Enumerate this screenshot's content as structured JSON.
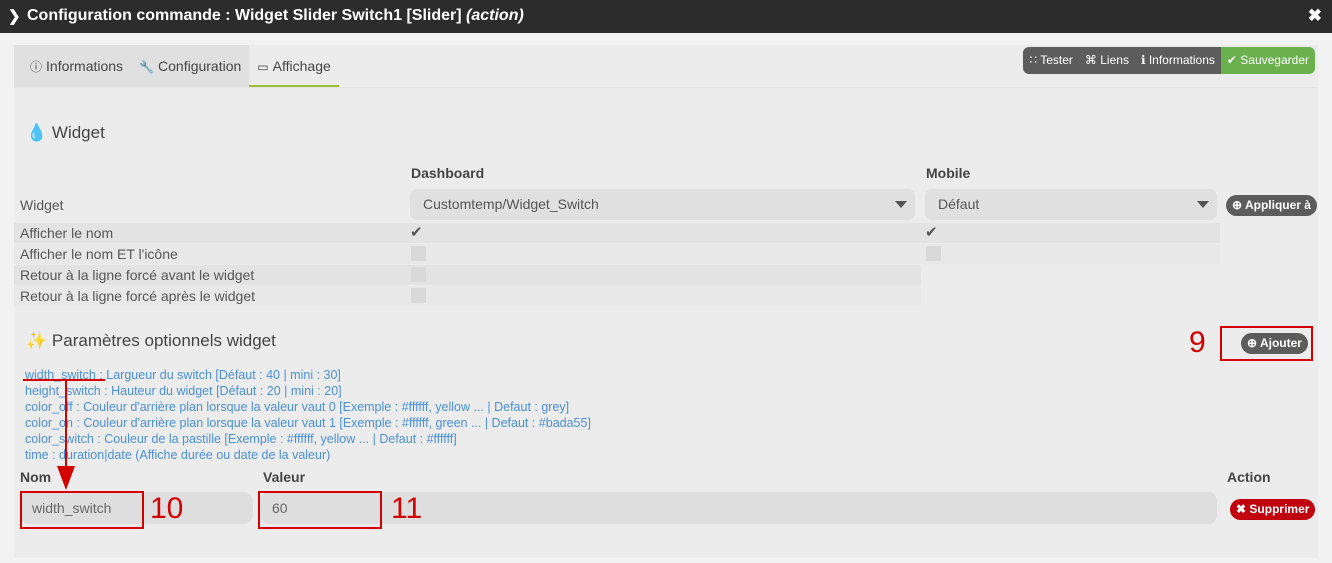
{
  "titlebar": {
    "chevron_icon": "chevron-right-icon",
    "title": "Configuration commande : Widget Slider Switch1 [Slider]",
    "title_italic": "(action)",
    "close_icon": "close-icon"
  },
  "tabs": [
    {
      "label": "Informations",
      "icon": "info-circle-icon"
    },
    {
      "label": "Configuration",
      "icon": "wrench-icon"
    },
    {
      "label": "Affichage",
      "icon": "monitor-icon",
      "active": true
    }
  ],
  "toolbar": {
    "tester": "Tester",
    "liens": "Liens",
    "informations": "Informations",
    "sauvegarder": "Sauvegarder"
  },
  "widget_section": {
    "title": "Widget",
    "icon": "droplet-icon",
    "col_dashboard": "Dashboard",
    "col_mobile": "Mobile",
    "widget_label": "Widget",
    "dashboard_select": "Customtemp/Widget_Switch",
    "mobile_select": "Défaut",
    "apply_button": "Appliquer à",
    "rows": [
      {
        "label": "Afficher le nom",
        "dashboard_checked": true,
        "mobile_checked": true
      },
      {
        "label": "Afficher le nom ET l'icône",
        "dashboard_checked": false,
        "mobile_checked": false
      },
      {
        "label": "Retour à la ligne forcé avant le widget",
        "dashboard_checked": false
      },
      {
        "label": "Retour à la ligne forcé après le widget",
        "dashboard_checked": false
      }
    ]
  },
  "params_section": {
    "title": "Paramètres optionnels widget",
    "icon": "magic-wand-icon",
    "add_button": "Ajouter",
    "help_lines": [
      "width_switch : Largueur du switch [Défaut : 40 | mini : 30]",
      "height_switch : Hauteur du widget [Défaut : 20 | mini : 20]",
      "color_off : Couleur d'arrière plan lorsque la valeur vaut 0 [Exemple : #ffffff, yellow ... | Defaut : grey]",
      "color_on : Couleur d'arrière plan lorsque la valeur vaut 1 [Exemple : #ffffff, green ... | Defaut : #bada55]",
      "color_switch : Couleur de la pastille [Exemple : #ffffff, yellow ... | Defaut : #ffffff]",
      "time : duration|date (Affiche durée ou date de la valeur)"
    ],
    "col_nom": "Nom",
    "col_valeur": "Valeur",
    "col_action": "Action",
    "param_name": "width_switch",
    "param_value": "60",
    "delete_button": "Supprimer"
  },
  "annotations": {
    "n9": "9",
    "n10": "10",
    "n11": "11",
    "color": "#d40000"
  }
}
